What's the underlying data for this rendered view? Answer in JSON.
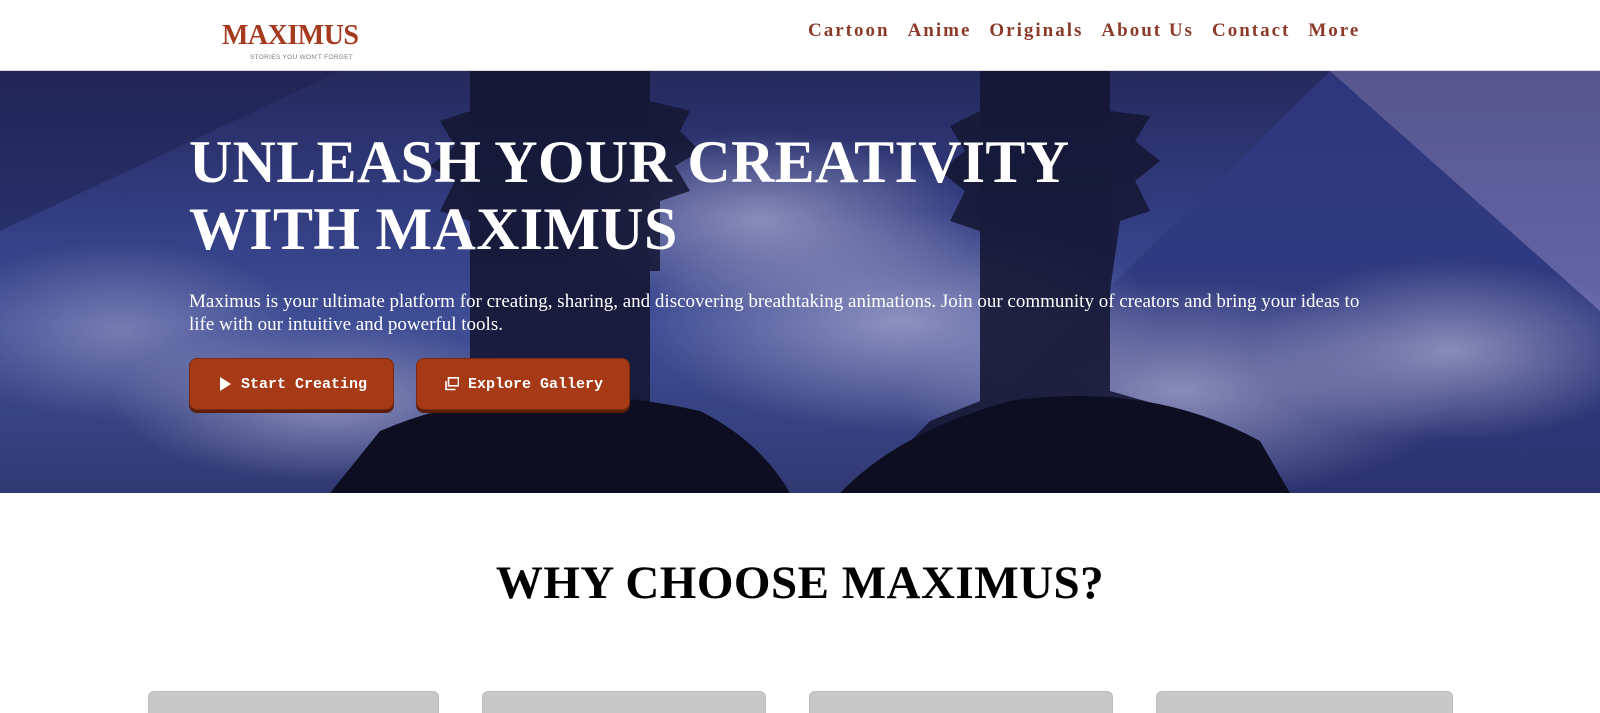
{
  "brand": {
    "name": "MAXIMUS",
    "tagline": "STORIES YOU WON'T FORGET",
    "color": "#a53a1f"
  },
  "nav": {
    "items": [
      "Cartoon",
      "Anime",
      "Originals",
      "About Us",
      "Contact",
      "More"
    ]
  },
  "hero": {
    "title_line1": "UNLEASH YOUR CREATIVITY",
    "title_line2": "WITH MAXIMUS",
    "description": "Maximus is your ultimate platform for creating, sharing, and discovering breathtaking animations. Join our community of creators and bring your ideas to life with our intuitive and powerful tools.",
    "buttons": [
      {
        "label": "Start Creating",
        "icon": "play-icon"
      },
      {
        "label": "Explore Gallery",
        "icon": "gallery-icon"
      }
    ],
    "button_color": "#a63a17"
  },
  "why": {
    "title": "WHY CHOOSE MAXIMUS?"
  }
}
